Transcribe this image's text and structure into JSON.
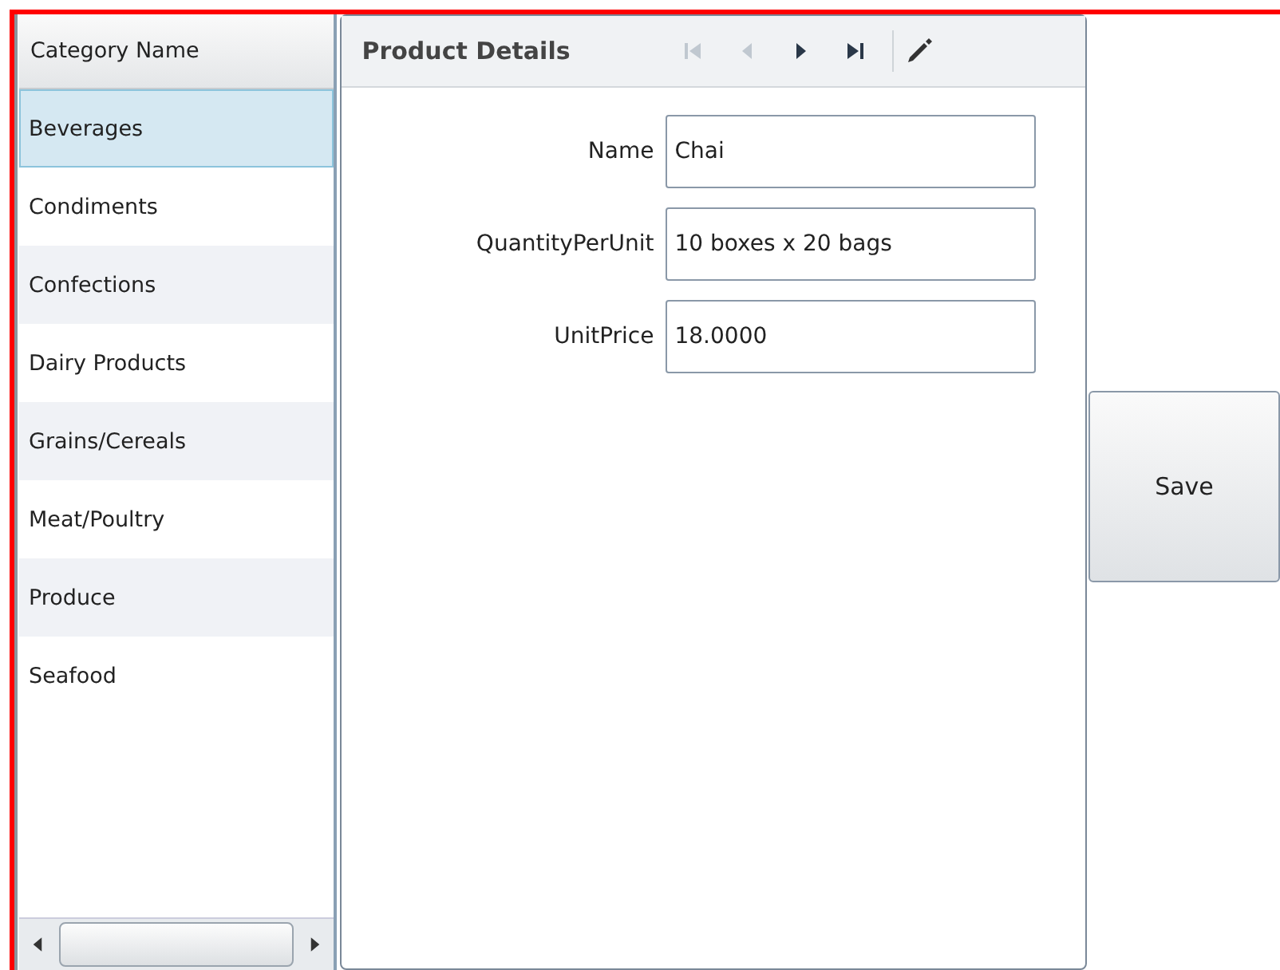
{
  "category_list": {
    "header": "Category Name",
    "items": [
      {
        "label": "Beverages",
        "selected": true
      },
      {
        "label": "Condiments",
        "selected": false
      },
      {
        "label": "Confections",
        "selected": false
      },
      {
        "label": "Dairy Products",
        "selected": false
      },
      {
        "label": "Grains/Cereals",
        "selected": false
      },
      {
        "label": "Meat/Poultry",
        "selected": false
      },
      {
        "label": "Produce",
        "selected": false
      },
      {
        "label": "Seafood",
        "selected": false
      }
    ]
  },
  "product_details": {
    "title": "Product Details",
    "nav_buttons": [
      {
        "kind": "first",
        "disabled": true
      },
      {
        "kind": "previous",
        "disabled": true
      },
      {
        "kind": "next",
        "disabled": false
      },
      {
        "kind": "last",
        "disabled": false
      }
    ],
    "fields": [
      {
        "label": "Name",
        "value": "Chai"
      },
      {
        "label": "QuantityPerUnit",
        "value": "10 boxes x 20 bags"
      },
      {
        "label": "UnitPrice",
        "value": "18.0000"
      }
    ]
  },
  "save_button": "Save"
}
